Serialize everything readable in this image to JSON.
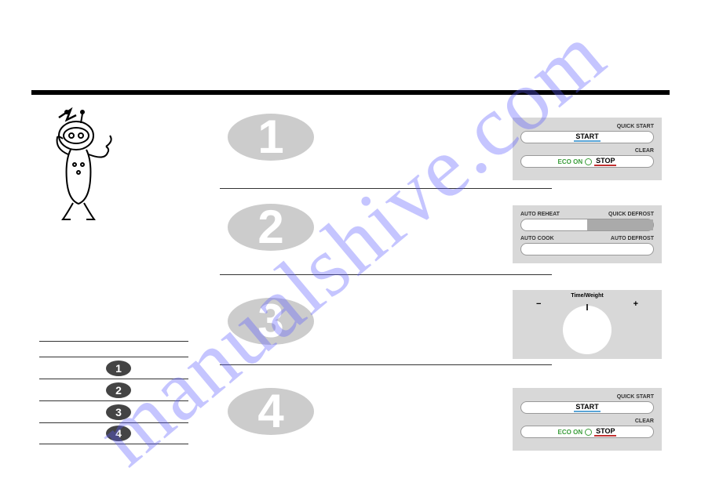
{
  "watermark": "manualshive.com",
  "panel1": {
    "label_right1": "QUICK START",
    "btn1": "START",
    "label_right2": "CLEAR",
    "eco": "ECO ON",
    "stop": "STOP"
  },
  "panel2": {
    "label_left1": "AUTO REHEAT",
    "label_right1": "QUICK DEFROST",
    "label_left2": "AUTO COOK",
    "label_right2": "AUTO DEFROST"
  },
  "panel3": {
    "label": "Time/Weight",
    "minus": "−",
    "plus": "+"
  },
  "panel4": {
    "label_right1": "QUICK START",
    "btn1": "START",
    "label_right2": "CLEAR",
    "eco": "ECO ON",
    "stop": "STOP"
  },
  "big_steps": [
    "1",
    "2",
    "3",
    "4"
  ],
  "small_steps": [
    "1",
    "2",
    "3",
    "4"
  ]
}
